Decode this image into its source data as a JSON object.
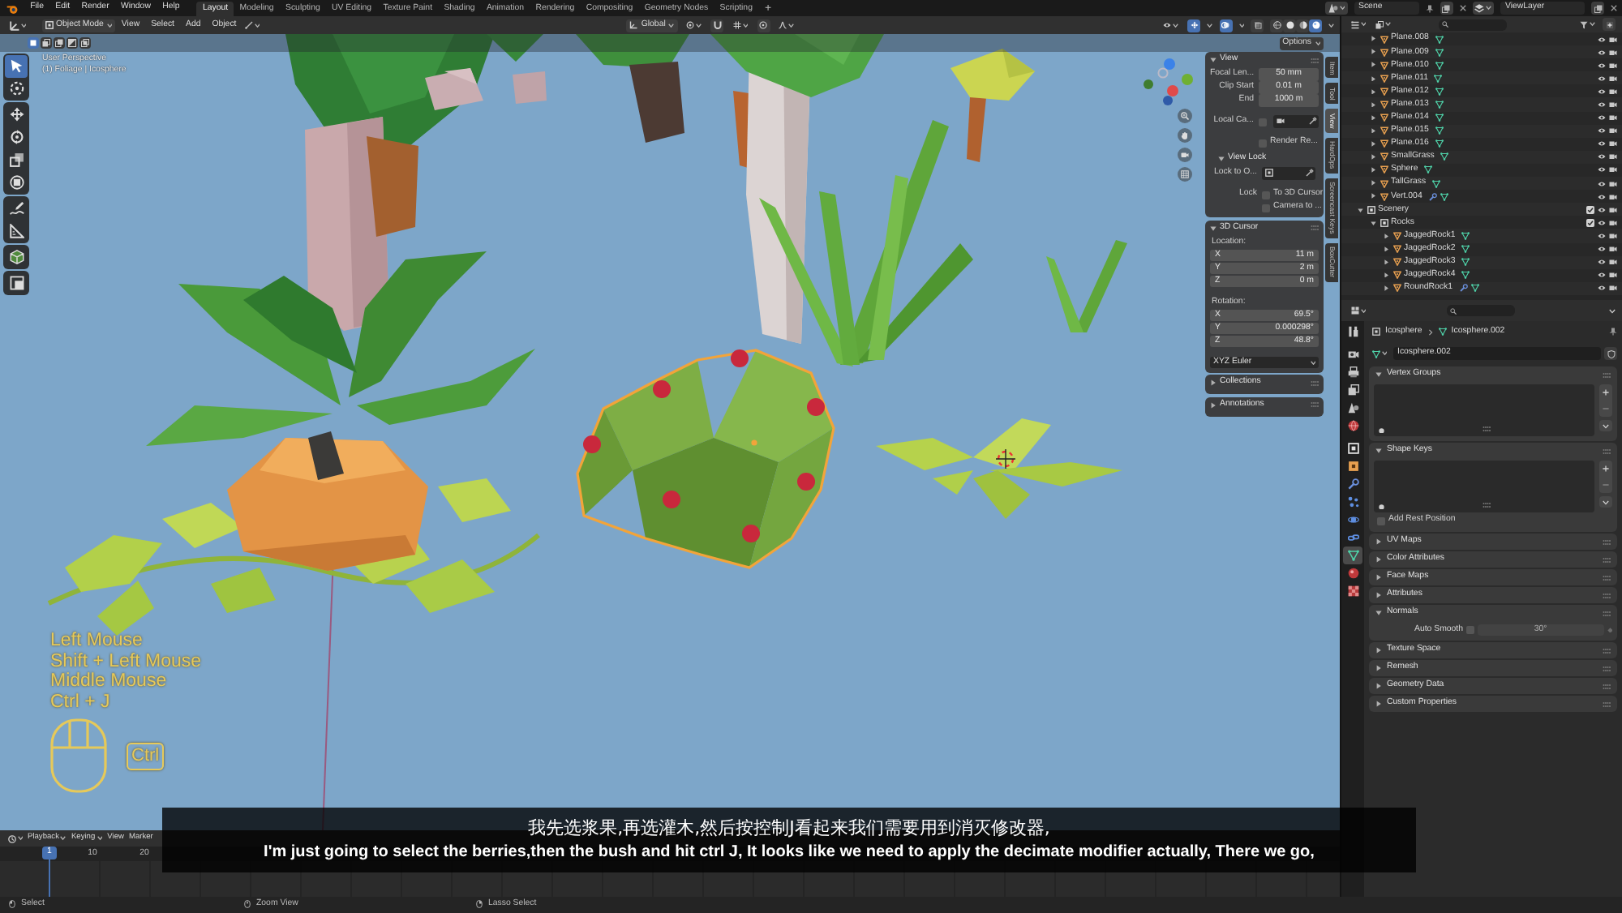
{
  "topbar": {
    "menus": [
      "File",
      "Edit",
      "Render",
      "Window",
      "Help"
    ],
    "workspaces": [
      {
        "label": "Layout",
        "selected": true
      },
      {
        "label": "Modeling",
        "selected": false
      },
      {
        "label": "Sculpting",
        "selected": false
      },
      {
        "label": "UV Editing",
        "selected": false
      },
      {
        "label": "Texture Paint",
        "selected": false
      },
      {
        "label": "Shading",
        "selected": false
      },
      {
        "label": "Animation",
        "selected": false
      },
      {
        "label": "Rendering",
        "selected": false
      },
      {
        "label": "Compositing",
        "selected": false
      },
      {
        "label": "Geometry Nodes",
        "selected": false
      },
      {
        "label": "Scripting",
        "selected": false
      }
    ],
    "add_workspace": "+",
    "scene": "Scene",
    "view_layer": "ViewLayer"
  },
  "viewport": {
    "mode": "Object Mode",
    "menus": [
      "View",
      "Select",
      "Add",
      "Object"
    ],
    "orientation": "Global",
    "shading": [
      {
        "kind": "wireframe",
        "selected": false
      },
      {
        "kind": "solid",
        "selected": false
      },
      {
        "kind": "material",
        "selected": false
      },
      {
        "kind": "rendered",
        "selected": true
      }
    ],
    "select_modes": [
      {
        "kind": "set",
        "selected": true
      },
      {
        "kind": "extend",
        "selected": false
      },
      {
        "kind": "subtract",
        "selected": false
      },
      {
        "kind": "invert",
        "selected": false
      },
      {
        "kind": "intersect",
        "selected": false
      }
    ],
    "options": "Options",
    "info": [
      "User Perspective",
      "(1) Foliage | Icosphere"
    ],
    "tools": [
      [
        {
          "kind": "select",
          "selected": true
        },
        {
          "kind": "cursor",
          "selected": false
        }
      ],
      [
        {
          "kind": "move",
          "selected": false
        },
        {
          "kind": "rotate",
          "selected": false
        },
        {
          "kind": "scale",
          "selected": false
        },
        {
          "kind": "transform",
          "selected": false
        }
      ],
      [
        {
          "kind": "annotate",
          "selected": false
        },
        {
          "kind": "measure",
          "selected": false
        }
      ],
      [
        {
          "kind": "add_cube",
          "selected": false
        }
      ],
      [
        {
          "kind": "custom",
          "selected": false
        }
      ]
    ],
    "bush": {
      "selected": true
    },
    "screencast": {
      "keys": [
        "Left Mouse",
        "Shift + Left Mouse",
        "Middle Mouse",
        "Ctrl + J"
      ],
      "key_cap": "Ctrl"
    }
  },
  "sidebar": {
    "tabs": [
      {
        "label": "Item",
        "selected": false
      },
      {
        "label": "Tool",
        "selected": false
      },
      {
        "label": "View",
        "selected": true
      },
      {
        "label": "HardOps",
        "selected": false
      },
      {
        "label": "Screencast Keys",
        "selected": false
      },
      {
        "label": "BoxCutter",
        "selected": false
      }
    ],
    "panels": [
      {
        "title": "View",
        "expanded": true,
        "rows": [
          {
            "kind": "field",
            "label": "Focal Len...",
            "value": "50 mm"
          },
          {
            "kind": "field",
            "label": "Clip Start",
            "value": "0.01 m"
          },
          {
            "kind": "field",
            "label": "End",
            "value": "1000 m"
          },
          {
            "kind": "local",
            "label": "Local Ca...",
            "checked": false
          },
          {
            "kind": "check",
            "text": "Render Re...",
            "checked": false
          }
        ],
        "subpanels": [
          {
            "title": "View Lock",
            "expanded": true,
            "rows": [
              {
                "kind": "picker",
                "label": "Lock to O..."
              },
              {
                "kind": "check",
                "label": "Lock",
                "text": "To 3D Cursor",
                "checked": false
              },
              {
                "kind": "check",
                "text": "Camera to ...",
                "checked": false
              }
            ]
          }
        ]
      },
      {
        "title": "3D Cursor",
        "expanded": true,
        "rows": [
          {
            "kind": "heading",
            "label": "Location:"
          },
          {
            "kind": "axis",
            "label": "X",
            "value": "11 m"
          },
          {
            "kind": "axis",
            "label": "Y",
            "value": "2 m"
          },
          {
            "kind": "axis",
            "label": "Z",
            "value": "0 m"
          },
          {
            "kind": "heading",
            "label": "Rotation:"
          },
          {
            "kind": "axis",
            "label": "X",
            "value": "69.5°"
          },
          {
            "kind": "axis",
            "label": "Y",
            "value": "0.000298°"
          },
          {
            "kind": "axis",
            "label": "Z",
            "value": "48.8°"
          },
          {
            "kind": "dropdown",
            "value": "XYZ Euler"
          }
        ]
      },
      {
        "title": "Collections",
        "expanded": false
      },
      {
        "title": "Annotations",
        "expanded": false
      }
    ]
  },
  "outliner": {
    "rows": [
      {
        "children": [
          {
            "name": "Plane.008",
            "kind": "mesh",
            "expanded": false,
            "modifiers": false
          },
          {
            "name": "Plane.009",
            "kind": "mesh",
            "expanded": false,
            "modifiers": false
          },
          {
            "name": "Plane.010",
            "kind": "mesh",
            "expanded": false,
            "modifiers": false
          },
          {
            "name": "Plane.011",
            "kind": "mesh",
            "expanded": false,
            "modifiers": false
          },
          {
            "name": "Plane.012",
            "kind": "mesh",
            "expanded": false,
            "modifiers": false
          },
          {
            "name": "Plane.013",
            "kind": "mesh",
            "expanded": false,
            "modifiers": false
          },
          {
            "name": "Plane.014",
            "kind": "mesh",
            "expanded": false,
            "modifiers": false
          },
          {
            "name": "Plane.015",
            "kind": "mesh",
            "expanded": false,
            "modifiers": false
          },
          {
            "name": "Plane.016",
            "kind": "mesh",
            "expanded": false,
            "modifiers": false
          },
          {
            "name": "SmallGrass",
            "kind": "mesh",
            "expanded": false,
            "modifiers": false
          },
          {
            "name": "Sphere",
            "kind": "mesh",
            "expanded": false,
            "modifiers": false
          },
          {
            "name": "TallGrass",
            "kind": "mesh",
            "expanded": false,
            "modifiers": false
          },
          {
            "name": "Vert.004",
            "kind": "mesh",
            "expanded": false,
            "modifiers": true
          }
        ]
      },
      {
        "name": "Scenery",
        "kind": "collection",
        "expanded": true,
        "checked": true,
        "children": [
          {
            "name": "Rocks",
            "kind": "collection",
            "expanded": true,
            "checked": true,
            "children": [
              {
                "name": "JaggedRock1",
                "kind": "mesh",
                "expanded": false,
                "modifiers": false
              },
              {
                "name": "JaggedRock2",
                "kind": "mesh",
                "expanded": false,
                "modifiers": false
              },
              {
                "name": "JaggedRock3",
                "kind": "mesh",
                "expanded": false,
                "modifiers": false
              },
              {
                "name": "JaggedRock4",
                "kind": "mesh",
                "expanded": false,
                "modifiers": false
              },
              {
                "name": "RoundRock1",
                "kind": "mesh",
                "expanded": false,
                "modifiers": true
              }
            ]
          }
        ]
      }
    ]
  },
  "properties": {
    "tabs": [
      [
        {
          "kind": "tool",
          "selected": false
        }
      ],
      [
        {
          "kind": "render",
          "selected": false
        },
        {
          "kind": "output",
          "selected": false
        },
        {
          "kind": "view_layer",
          "selected": false
        },
        {
          "kind": "scene",
          "selected": false
        },
        {
          "kind": "world",
          "selected": false
        }
      ],
      [
        {
          "kind": "collection",
          "selected": false
        },
        {
          "kind": "object",
          "selected": false
        },
        {
          "kind": "modifiers",
          "selected": false
        },
        {
          "kind": "particles",
          "selected": false
        },
        {
          "kind": "physics",
          "selected": false
        },
        {
          "kind": "constraints",
          "selected": false
        },
        {
          "kind": "data",
          "selected": true
        },
        {
          "kind": "material",
          "selected": false
        },
        {
          "kind": "texture",
          "selected": false
        }
      ]
    ],
    "breadcrumb": [
      "Icosphere",
      "Icosphere.002"
    ],
    "mesh_name": "Icosphere.002",
    "panels": [
      {
        "title": "Vertex Groups",
        "expanded": true,
        "rows": [
          {
            "kind": "list"
          }
        ]
      },
      {
        "title": "Shape Keys",
        "expanded": true,
        "rows": [
          {
            "kind": "list"
          },
          {
            "kind": "check",
            "label": "Add Rest Position",
            "checked": false
          }
        ]
      },
      {
        "title": "UV Maps",
        "expanded": false
      },
      {
        "title": "Color Attributes",
        "expanded": false
      },
      {
        "title": "Face Maps",
        "expanded": false
      },
      {
        "title": "Attributes",
        "expanded": false
      },
      {
        "title": "Normals",
        "expanded": true,
        "rows": [
          {
            "kind": "toggle_value",
            "label": "Auto Smooth",
            "checked": false,
            "value": "30°"
          }
        ]
      },
      {
        "title": "Texture Space",
        "expanded": false
      },
      {
        "title": "Remesh",
        "expanded": false
      },
      {
        "title": "Geometry Data",
        "expanded": false
      },
      {
        "title": "Custom Properties",
        "expanded": false
      }
    ]
  },
  "timeline": {
    "menus": [
      "Playback",
      "Keying",
      "View",
      "Marker"
    ],
    "current_frame": "1",
    "ruler": [
      "10",
      "20"
    ]
  },
  "status_bar": [
    {
      "kind": "left",
      "label": "Select"
    },
    {
      "kind": "middle",
      "label": "Zoom View"
    },
    {
      "kind": "right",
      "label": "Lasso Select"
    }
  ],
  "subtitles": {
    "translation": "我先选浆果,再选灌木,然后按控制J看起来我们需要用到消灭修改器,",
    "original": "I'm just going to select the berries,then the bush and hit ctrl J, It looks like we need to apply the decimate modifier actually, There we go,"
  }
}
